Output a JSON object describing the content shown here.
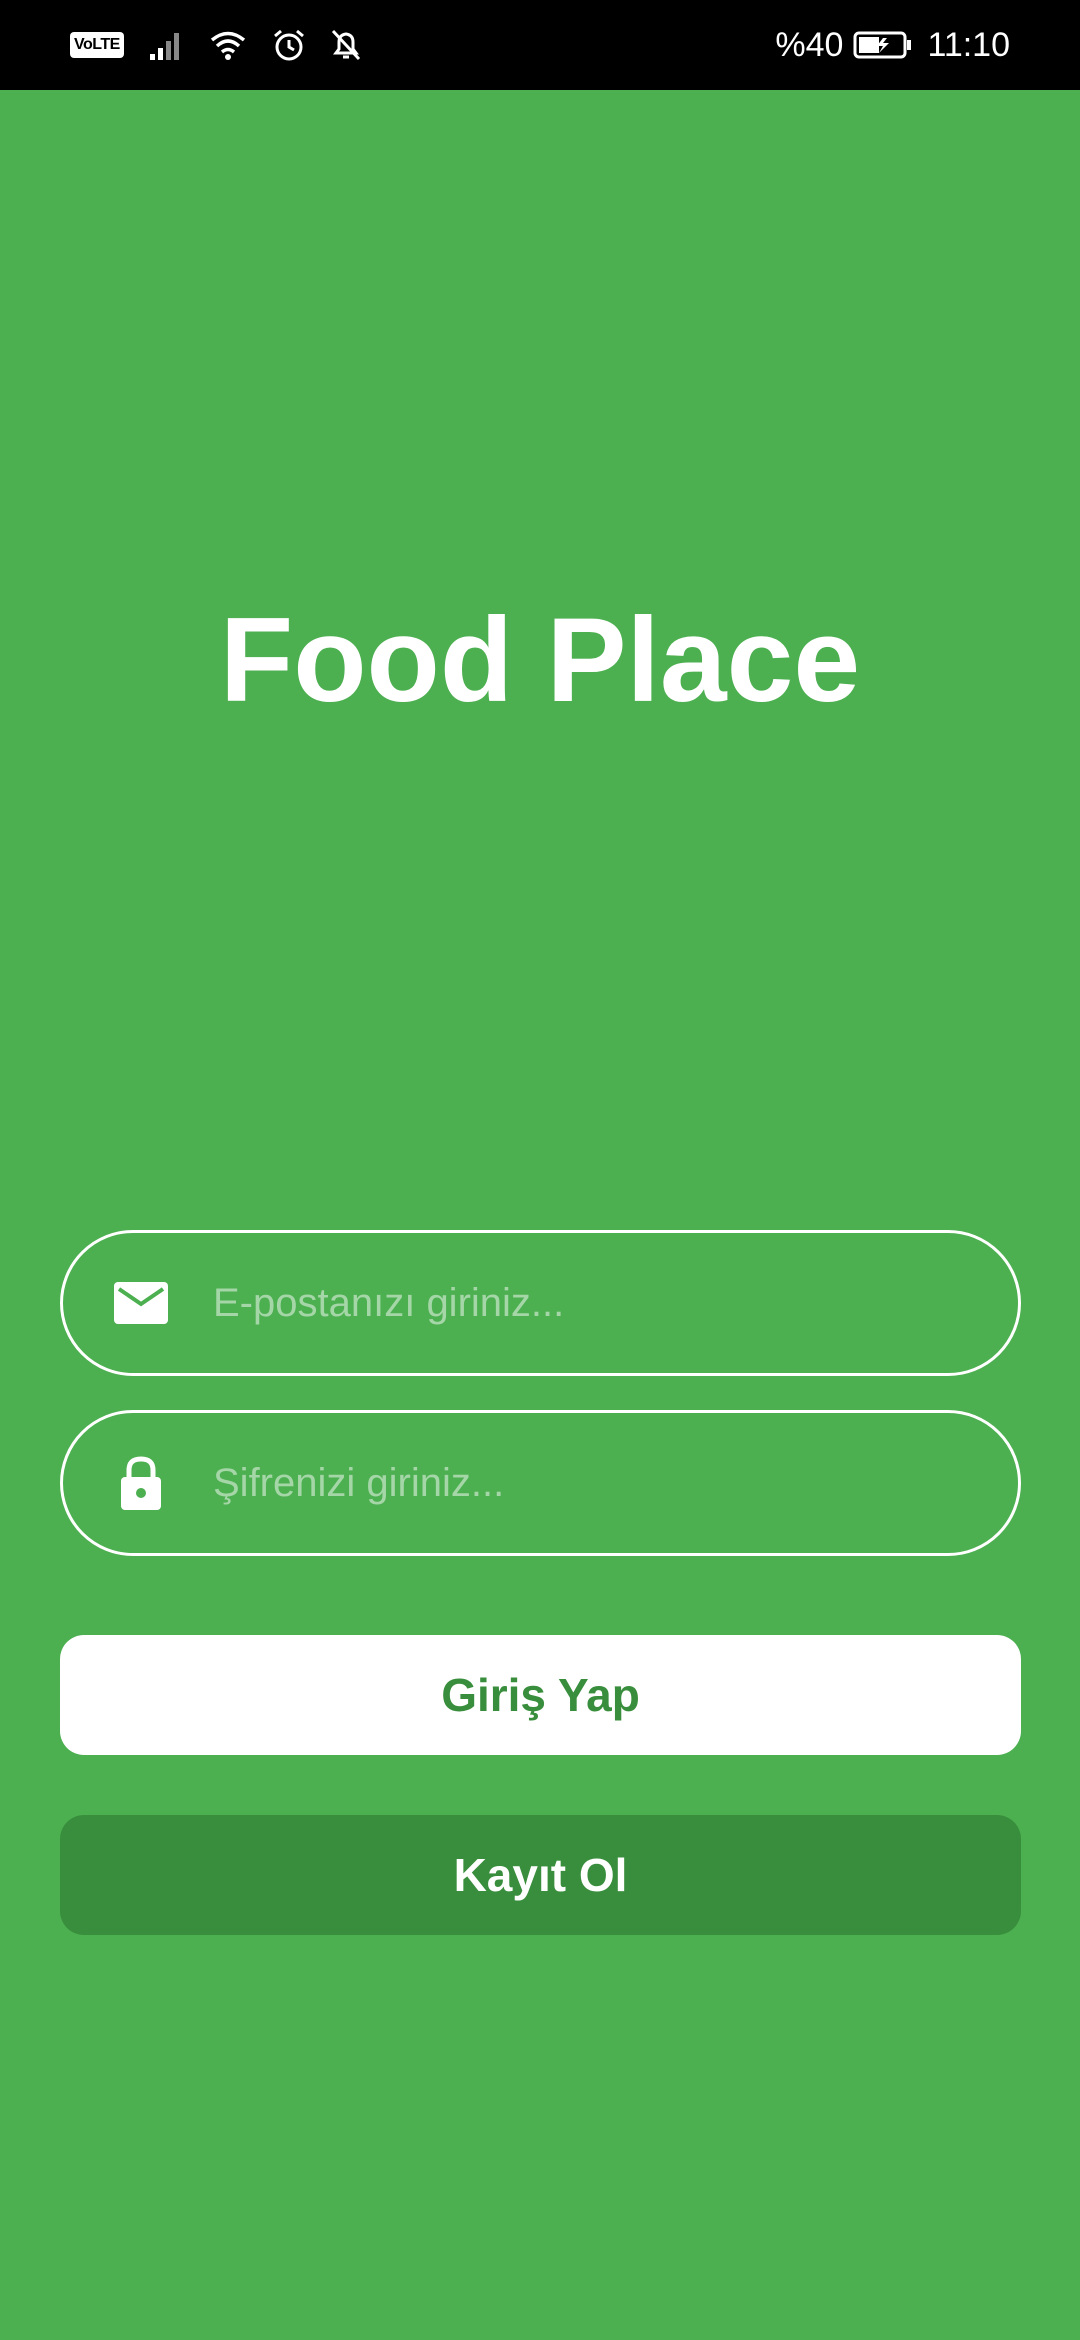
{
  "status_bar": {
    "network_badge": "VoLTE",
    "battery_percent": "%40",
    "time": "11:10",
    "icons": [
      "volte-icon",
      "signal-icon",
      "wifi-icon",
      "alarm-icon",
      "notifications-off-icon",
      "battery-charging-icon"
    ]
  },
  "app": {
    "title": "Food Place"
  },
  "form": {
    "email": {
      "placeholder": "E-postanızı giriniz...",
      "value": "",
      "icon": "mail-icon"
    },
    "password": {
      "placeholder": "Şifrenizi giriniz...",
      "value": "",
      "icon": "lock-icon"
    },
    "login_label": "Giriş Yap",
    "register_label": "Kayıt Ol"
  },
  "colors": {
    "background": "#4caf50",
    "accent_dark": "#388e3c",
    "text_primary": "#ffffff",
    "placeholder": "#a5d6a7",
    "status_bar": "#000000"
  }
}
